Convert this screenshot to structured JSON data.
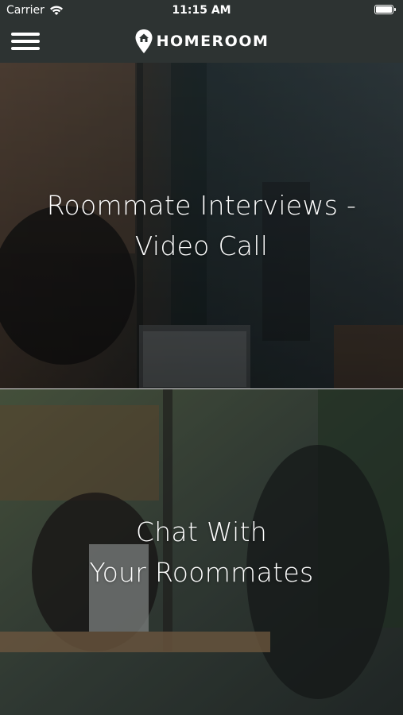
{
  "status_bar": {
    "carrier": "Carrier",
    "time": "11:15 AM"
  },
  "navbar": {
    "brand": "HOMEROOM",
    "menu_icon": "hamburger-menu-icon",
    "logo_icon": "map-pin-house-icon"
  },
  "cards": [
    {
      "line1": "Roommate Interviews -",
      "line2": "Video Call"
    },
    {
      "line1": "Chat With",
      "line2": "Your Roommates"
    }
  ],
  "colors": {
    "header_bg": "#2d3332",
    "text": "#ffffff"
  }
}
